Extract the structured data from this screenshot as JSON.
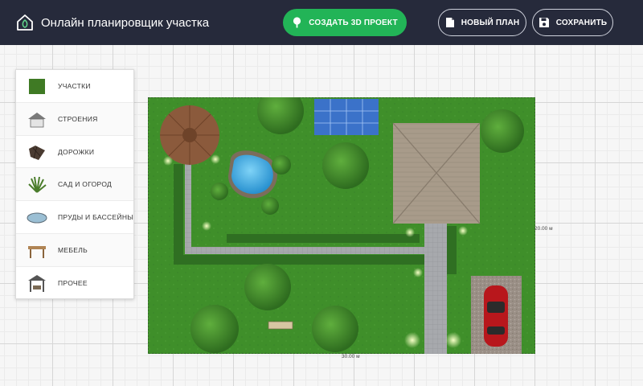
{
  "header": {
    "title": "Онлайн планировщик участка",
    "create_3d_label": "СОЗДАТЬ 3D ПРОЕКТ",
    "new_plan_label": "НОВЫЙ ПЛАН",
    "save_label": "СОХРАНИТЬ"
  },
  "categories": [
    {
      "label": "УЧАСТКИ",
      "icon": "plot-icon"
    },
    {
      "label": "СТРОЕНИЯ",
      "icon": "house-icon"
    },
    {
      "label": "ДОРОЖКИ",
      "icon": "paving-tiles-icon"
    },
    {
      "label": "САД И ОГОРОД",
      "icon": "shrub-icon"
    },
    {
      "label": "ПРУДЫ И БАССЕЙНЫ",
      "icon": "pool-icon"
    },
    {
      "label": "МЕБЕЛЬ",
      "icon": "table-icon"
    },
    {
      "label": "ПРОЧЕЕ",
      "icon": "gazebo-icon"
    }
  ],
  "plot": {
    "width_label": "30.00 м",
    "height_label": "20.00 м"
  },
  "colors": {
    "topbar": "#262a3b",
    "accent_green": "#22b457",
    "lawn": "#3f8f2a"
  }
}
